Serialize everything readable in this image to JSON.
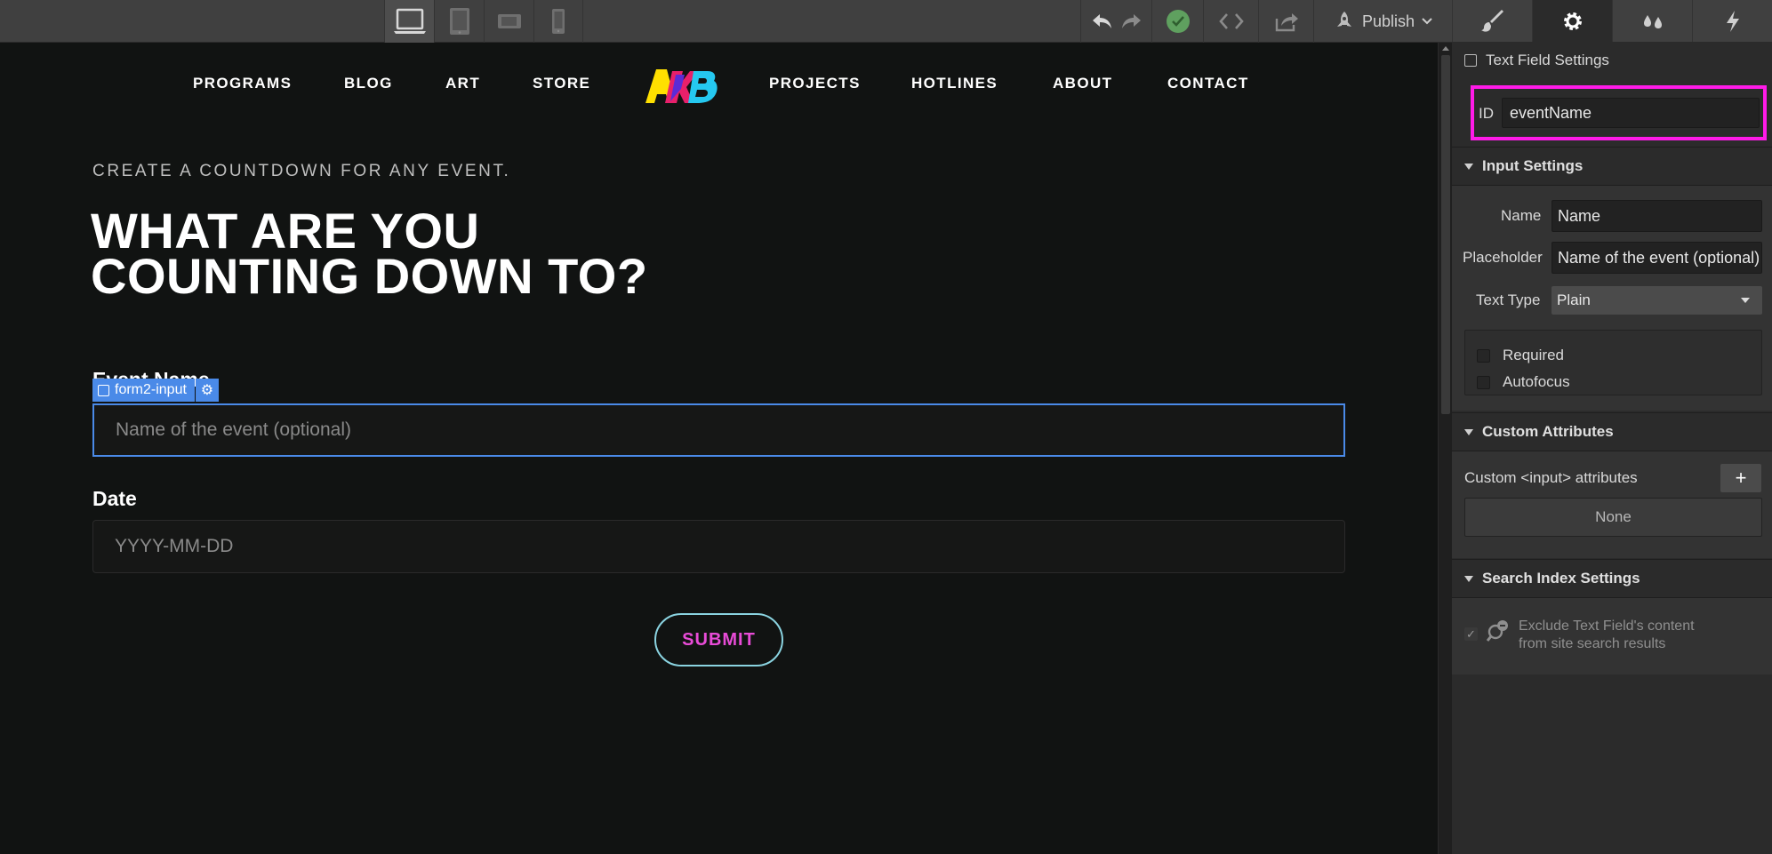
{
  "toolbar": {
    "devices": [
      "desktop-icon",
      "tablet-icon",
      "mobile-landscape-icon",
      "mobile-portrait-icon"
    ],
    "publish_label": "Publish"
  },
  "panel_tabs": [
    "style-brush-icon",
    "settings-gear-icon",
    "interactions-drops-icon",
    "lightning-icon"
  ],
  "site": {
    "nav_left": [
      "PROGRAMS",
      "BLOG",
      "ART",
      "STORE"
    ],
    "nav_right": [
      "PROJECTS",
      "HOTLINES",
      "ABOUT",
      "CONTACT"
    ],
    "logo_text": "AKB",
    "eyebrow": "CREATE A COUNTDOWN FOR ANY EVENT.",
    "headline_line1": "WHAT ARE YOU",
    "headline_line2": "COUNTING DOWN TO?",
    "event_label": "Event Name",
    "event_placeholder": "Name of the event (optional)",
    "date_label": "Date",
    "date_placeholder": "YYYY-MM-DD",
    "submit_label": "SUBMIT",
    "selection_tag": "form2-input"
  },
  "panel": {
    "title": "Text Field Settings",
    "id_label": "ID",
    "id_value": "eventName",
    "input_settings": {
      "heading": "Input Settings",
      "name_label": "Name",
      "name_value": "Name",
      "placeholder_label": "Placeholder",
      "placeholder_value": "Name of the event (optional)",
      "text_type_label": "Text Type",
      "text_type_value": "Plain",
      "required_label": "Required",
      "autofocus_label": "Autofocus"
    },
    "custom_attributes": {
      "heading": "Custom Attributes",
      "label": "Custom <input> attributes",
      "add_symbol": "+",
      "empty_label": "None"
    },
    "search_index": {
      "heading": "Search Index Settings",
      "exclude_line1": "Exclude Text Field's content",
      "exclude_line2": "from site search results"
    }
  },
  "colors": {
    "selection_blue": "#4a8ae8",
    "highlight_magenta": "#ff1be8",
    "submit_text": "#e84bd7",
    "submit_border": "#8ad3e0",
    "status_green": "#5fa05f"
  }
}
